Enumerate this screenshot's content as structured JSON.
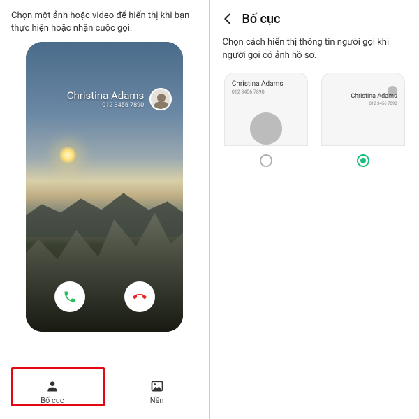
{
  "left": {
    "headerText": "Chọn một ảnh hoặc video để hiển thị khi bạn thực hiện hoặc nhận cuộc gọi.",
    "caller": {
      "name": "Christina Adams",
      "number": "012 3456 7890"
    },
    "tabs": {
      "layout": "Bố cục",
      "background": "Nền"
    }
  },
  "right": {
    "title": "Bố cục",
    "desc": "Chọn cách hiển thị thông tin người gọi khi người gọi có ảnh hồ sơ.",
    "sample": {
      "name": "Christina Adams",
      "number": "012 3456 7890"
    },
    "selected": 1
  }
}
